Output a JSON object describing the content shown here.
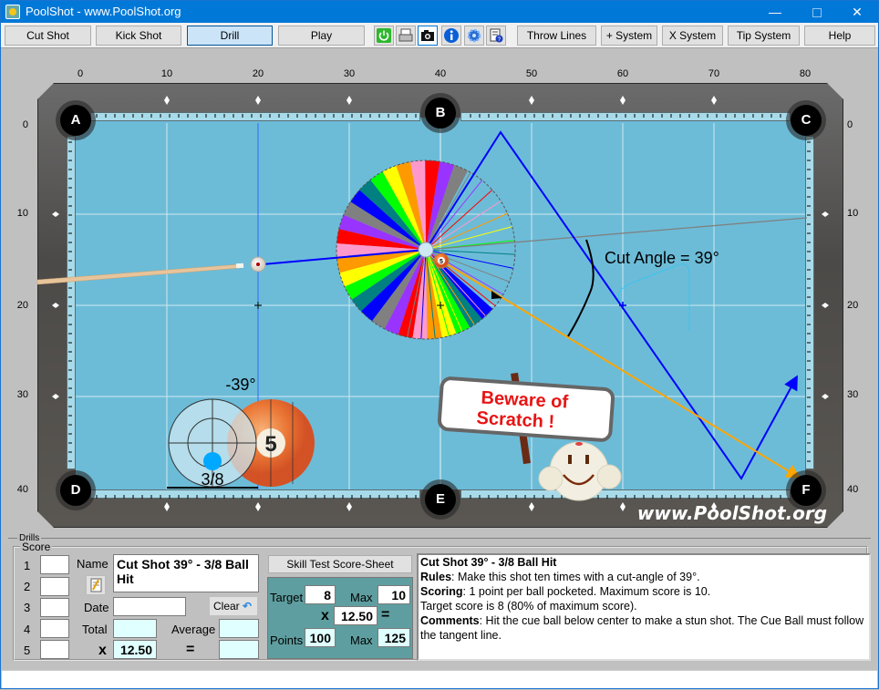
{
  "window": {
    "title": "PoolShot - www.PoolShot.org",
    "controls": {
      "minimize": "—",
      "close": "✕"
    }
  },
  "toolbar": {
    "buttons": [
      {
        "label": "Cut Shot",
        "active": false
      },
      {
        "label": "Kick Shot",
        "active": false
      },
      {
        "label": "Drill",
        "active": true
      },
      {
        "label": "Play",
        "active": false
      }
    ],
    "icons": [
      "power-icon",
      "print-icon",
      "camera-icon",
      "info-icon",
      "settings-gear-icon",
      "help-document-icon"
    ],
    "right_buttons": [
      "Throw Lines",
      "+ System",
      "X System",
      "Tip System",
      "Help"
    ]
  },
  "table": {
    "x_axis": [
      "0",
      "10",
      "20",
      "30",
      "40",
      "50",
      "60",
      "70",
      "80"
    ],
    "y_axis": [
      "0",
      "10",
      "20",
      "30",
      "40"
    ],
    "pockets": [
      "A",
      "B",
      "C",
      "D",
      "E",
      "F"
    ],
    "cut_angle_label": "Cut Angle = 39°",
    "aim_angle_label": "-39°",
    "ball_fraction_label": "3/8",
    "object_ball_number": "5",
    "sign_text_line1": "Beware of",
    "sign_text_line2": "Scratch !",
    "watermark": "www.PoolShot.org",
    "colors": {
      "cloth": "#6cbcd8",
      "aim_line": "#0000ff",
      "object_ball_path": "#ffa500",
      "tangent_line": "#808080"
    }
  },
  "drills": {
    "group_label": "Drills",
    "score_label": "Score",
    "score_rows": [
      "1",
      "2",
      "3",
      "4",
      "5"
    ],
    "score_values": [
      "",
      "",
      "",
      "",
      ""
    ],
    "name_label": "Name",
    "name_value": "Cut Shot 39° - 3/8 Ball Hit",
    "date_label": "Date",
    "date_value": "",
    "clear_label": "Clear",
    "total_label": "Total",
    "total_value": "",
    "average_label": "Average",
    "average_value": "",
    "multiplier_symbol": "x",
    "multiplier_value": "12.50",
    "equals_symbol": "=",
    "result_value": "",
    "skill_test": {
      "button_label": "Skill Test Score-Sheet",
      "target_label": "Target",
      "target_value": "8",
      "max_label": "Max",
      "max_value": "10",
      "x_symbol": "x",
      "multiplier_value": "12.50",
      "equals_symbol": "=",
      "points_label": "Points",
      "points_value": "100",
      "points_max_label": "Max",
      "points_max_value": "125"
    },
    "description": {
      "title": "Cut Shot 39° - 3/8 Ball Hit",
      "rules_label": "Rules",
      "rules_text": ": Make this shot ten times with a cut-angle of 39°.",
      "scoring_label": "Scoring",
      "scoring_text": ": 1 point per ball pocketed. Maximum score is 10.",
      "target_text": "Target score is 8 (80% of maximum score).",
      "comments_label": "Comments",
      "comments_text": ": Hit the cue ball below center to make a stun shot. The Cue Ball must follow the tangent line."
    }
  }
}
